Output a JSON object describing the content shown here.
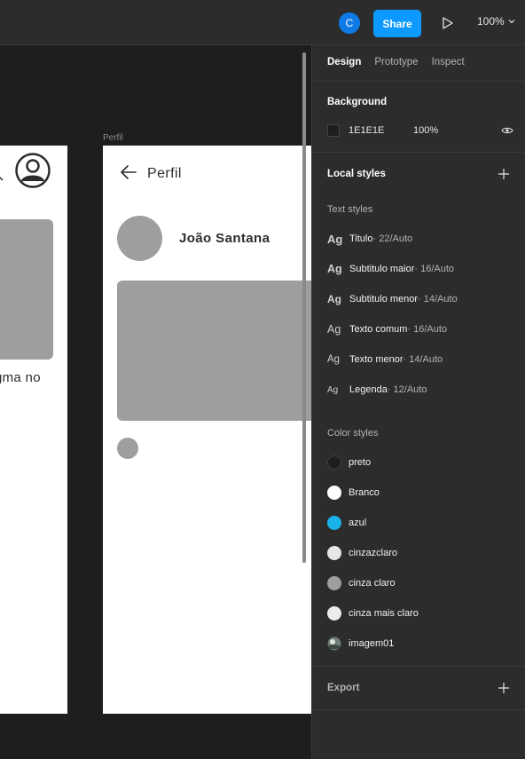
{
  "topbar": {
    "avatar_initial": "C",
    "share_label": "Share",
    "zoom": "100%"
  },
  "canvas": {
    "frame_a": {
      "partial_text": "gma no"
    },
    "frame_b": {
      "label": "Perfil",
      "title": "Perfil",
      "name": "João Santana"
    }
  },
  "panel": {
    "tabs": [
      "Design",
      "Prototype",
      "Inspect"
    ],
    "background": {
      "title": "Background",
      "hex": "1E1E1E",
      "opacity": "100%"
    },
    "local_styles": {
      "title": "Local styles",
      "text_styles_title": "Text styles",
      "text_styles": [
        {
          "ag": "Ag",
          "name": "Titulo",
          "meta": " · 22/Auto"
        },
        {
          "ag": "Ag",
          "name": "Subtitulo maior",
          "meta": " · 16/Auto"
        },
        {
          "ag": "Ag",
          "name": "Subtitulo menor",
          "meta": " · 14/Auto"
        },
        {
          "ag": "Ag",
          "name": "Texto comum",
          "meta": " · 16/Auto"
        },
        {
          "ag": "Ag",
          "name": "Texto menor",
          "meta": " · 14/Auto"
        },
        {
          "ag": "Ag",
          "name": "Legenda",
          "meta": " · 12/Auto"
        }
      ],
      "color_styles_title": "Color styles",
      "color_styles": [
        {
          "name": "preto",
          "color": "#1e1e1e"
        },
        {
          "name": "Branco",
          "color": "#ffffff"
        },
        {
          "name": "azul",
          "color": "#1ab3e8"
        },
        {
          "name": "cinzazclaro",
          "color": "#e6e6e6"
        },
        {
          "name": "cinza claro",
          "color": "#9e9e9e"
        },
        {
          "name": "cinza mais claro",
          "color": "#ebebeb"
        },
        {
          "name": "imagem01",
          "color": "image"
        }
      ]
    },
    "export": {
      "title": "Export"
    }
  }
}
